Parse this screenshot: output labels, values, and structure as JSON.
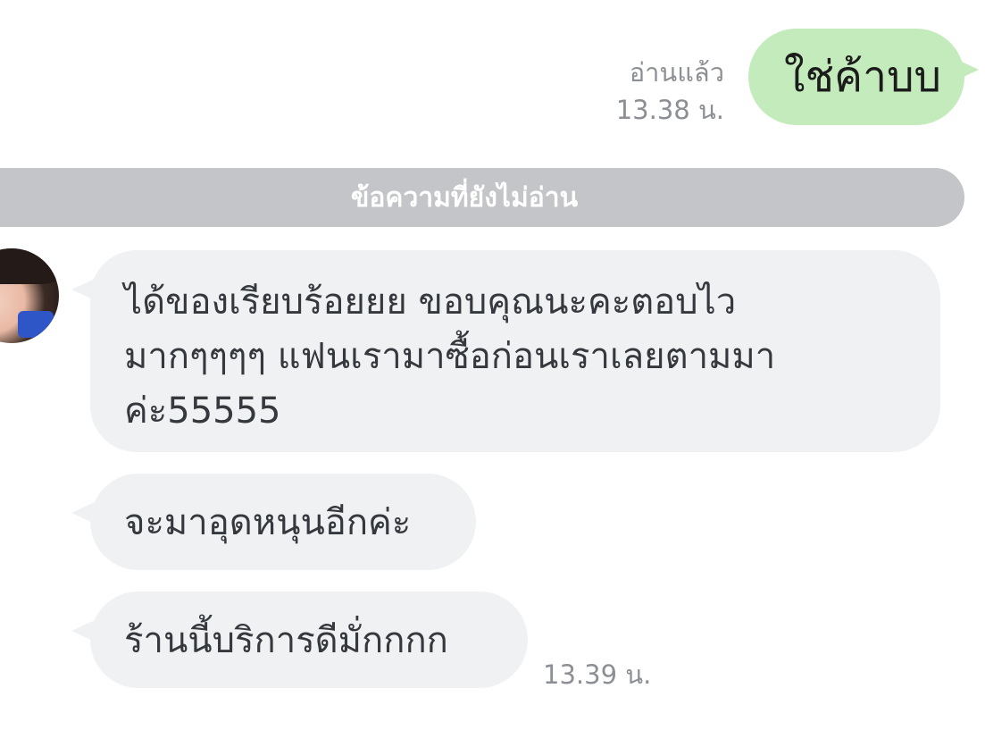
{
  "outgoing": {
    "read_status": "อ่านแล้ว",
    "time": "13.38 น.",
    "text": "ใช่ค้าบบ"
  },
  "divider": {
    "label": "ข้อความที่ยังไม่อ่าน"
  },
  "incoming": {
    "messages": [
      {
        "lines": [
          "ได้ของเรียบร้อยยย ขอบคุณนะคะตอบไว",
          "มากๆๆๆๆ แฟนเรามาซื้อก่อนเราเลยตามมา",
          "ค่ะ55555"
        ]
      },
      {
        "text": "จะมาอุดหนุนอีกค่ะ"
      },
      {
        "text": "ร้านนี้บริการดีมั่กกกก"
      }
    ],
    "time": "13.39 น."
  },
  "colors": {
    "outgoing_bubble": "#c3ebbb",
    "incoming_bubble": "#f0f1f3",
    "divider": "#c4c5c8",
    "meta_text": "#8c8f94"
  }
}
